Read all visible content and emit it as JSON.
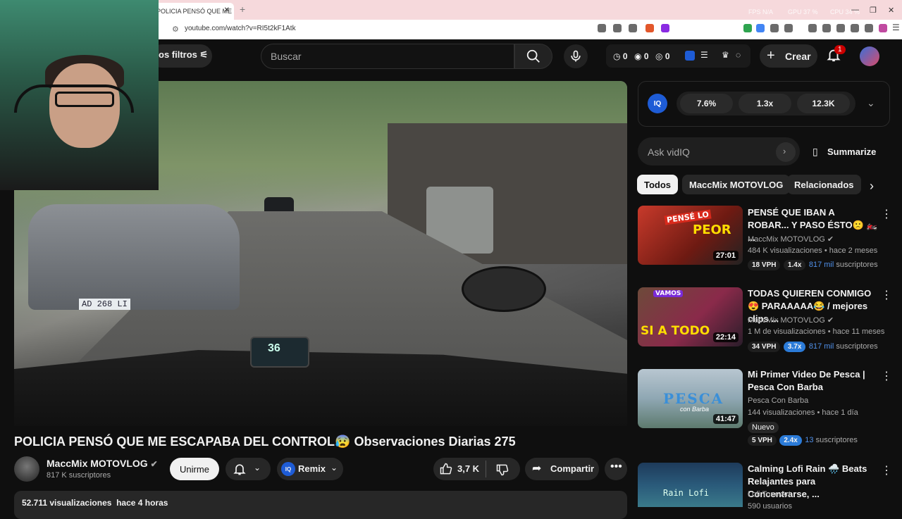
{
  "browser": {
    "tab_title": "POLICIA PENSÓ QUE ME E",
    "tab_close": "✕",
    "new_tab": "+",
    "url": "youtube.com/watch?v=RI5t2kF1Atk",
    "perf": {
      "fps_label": "FPS",
      "fps_value": "N/A",
      "gpu_label": "GPU",
      "gpu_value": "37 %",
      "cpu_label": "CPU",
      "cpu_value": "34 %"
    },
    "window_controls": [
      "—",
      "❐",
      "✕"
    ]
  },
  "header": {
    "filters_label": "os filtros",
    "search_placeholder": "Buscar",
    "stats": [
      "0",
      "0",
      "0"
    ],
    "create_label": "Crear",
    "notification_count": "1"
  },
  "video": {
    "plate": "AD 268 LI",
    "speed": "36",
    "title": "POLICIA PENSÓ QUE ME ESCAPABA DEL CONTROL😰 Observaciones Diarias 275"
  },
  "channel": {
    "name": "MaccMix MOTOVLOG",
    "subs": "817 K suscriptores",
    "subscribe_label": "Unirme",
    "remix_label": "Remix",
    "likes": "3,7 K",
    "share_label": "Compartir"
  },
  "description": {
    "views": "52.711 visualizaciones",
    "age": "hace 4 horas"
  },
  "vidiq": {
    "logo": "IQ",
    "stats": [
      "7.6%",
      "1.3x",
      "12.3K"
    ],
    "ask_placeholder": "Ask vidIQ",
    "summarize_label": "Summarize"
  },
  "chips": [
    "Todos",
    "MaccMix MOTOVLOG",
    "Relacionados"
  ],
  "related": [
    {
      "title": "PENSÉ QUE IBAN A ROBAR... Y PASO ÉSTO🙁 🏍️ ...",
      "channel": "MaccMix MOTOVLOG",
      "meta": "484 K visualizaciones • hace 2 meses",
      "duration": "27:01",
      "vph": "18 VPH",
      "mult": "1.4x",
      "subs_num": "817 mil",
      "subs_label": "suscriptores",
      "overlay_a": "PENSÉ LO",
      "overlay_b": "PEOR",
      "badge": ""
    },
    {
      "title": "TODAS QUIEREN CONMIGO😍 PARAAAAA😂 / mejores clips ...",
      "channel": "MaccMix MOTOVLOG",
      "meta": "1 M de visualizaciones • hace 11 meses",
      "duration": "22:14",
      "vph": "34 VPH",
      "mult": "3.7x",
      "subs_num": "817 mil",
      "subs_label": "suscriptores",
      "overlay_a": "VAMOS",
      "overlay_b": "SI A TODO",
      "badge": ""
    },
    {
      "title": "Mi Primer Video De Pesca | Pesca Con Barba",
      "channel": "Pesca Con Barba",
      "meta": "144 visualizaciones • hace 1 día",
      "duration": "41:47",
      "vph": "5 VPH",
      "mult": "2.4x",
      "subs_num": "13",
      "subs_label": "suscriptores",
      "overlay_a": "PESCA",
      "overlay_b": "con Barba",
      "badge": "Nuevo"
    },
    {
      "title": "Calming Lofi Rain 🌧️ Beats Relajantes para Concentrarse, ...",
      "channel": "Lofi Tone Art",
      "meta": "590 usuarios",
      "duration": "",
      "vph": "",
      "mult": "",
      "subs_num": "",
      "subs_label": "",
      "overlay_a": "Rain Lofi",
      "overlay_b": "",
      "badge": ""
    }
  ]
}
